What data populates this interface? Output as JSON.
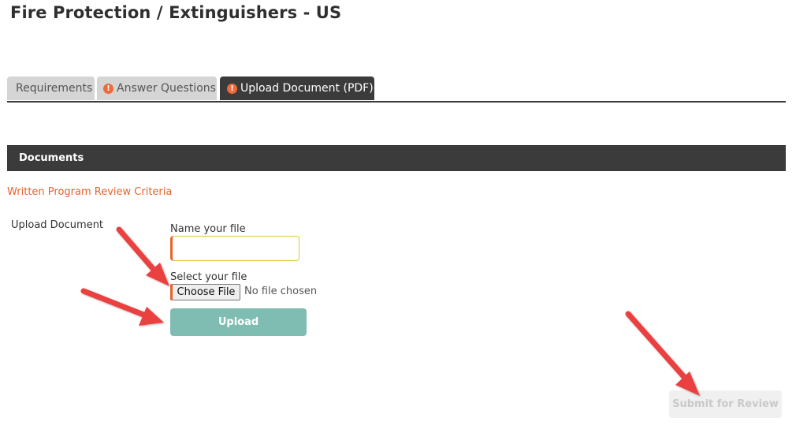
{
  "page": {
    "title": "Fire Protection / Extinguishers - US"
  },
  "tabs": [
    {
      "label": "Requirements",
      "icon": "none",
      "active": false
    },
    {
      "label": "Answer Questions",
      "icon": "warning-icon",
      "active": false
    },
    {
      "label": "Upload Document (PDF)",
      "icon": "warning-icon",
      "active": true
    }
  ],
  "warning_icon_glyph": "!",
  "documents": {
    "header": "Documents",
    "criteria_link": "Written Program Review Criteria"
  },
  "upload_form": {
    "section_label": "Upload Document",
    "name_label": "Name your file",
    "name_value": "",
    "select_label": "Select your file",
    "choose_file_label": "Choose File",
    "no_file_text": "No file chosen",
    "upload_button": "Upload"
  },
  "actions": {
    "submit_button": "Submit for Review"
  },
  "colors": {
    "accent_orange": "#e8622c",
    "dark_bar": "#3b3b3b",
    "upload_teal": "#7fbcb2",
    "annotation_red": "#ea4040"
  }
}
